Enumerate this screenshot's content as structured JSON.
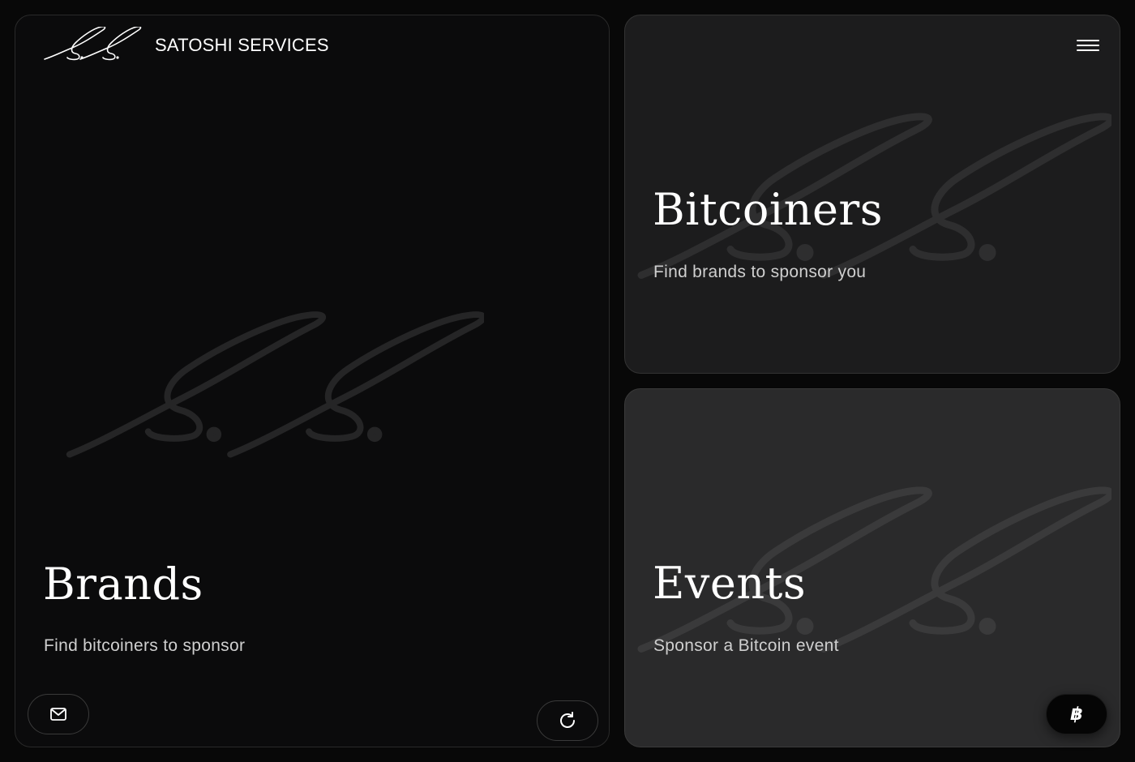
{
  "header": {
    "brand_name": "SATOSHI SERVICES",
    "logo_icon": "ss-signature-logo",
    "menu_icon": "hamburger-menu-icon"
  },
  "cards": [
    {
      "title": "Brands",
      "subtitle": "Find bitcoiners to sponsor"
    },
    {
      "title": "Bitcoiners",
      "subtitle": "Find brands to sponsor you"
    },
    {
      "title": "Events",
      "subtitle": "Sponsor a Bitcoin event"
    }
  ],
  "buttons": {
    "mail_icon": "mail-icon",
    "refresh_icon": "refresh-icon",
    "bitcoin_icon": "bitcoin-icon",
    "bitcoin_glyph": "฿"
  },
  "colors": {
    "page_background": "#080808",
    "brands_card": "#0b0b0c",
    "bitcoiners_card": "#1c1c1d",
    "events_card": "#2a2a2b",
    "text": "#ffffff",
    "subtext": "#cfcfcf"
  }
}
